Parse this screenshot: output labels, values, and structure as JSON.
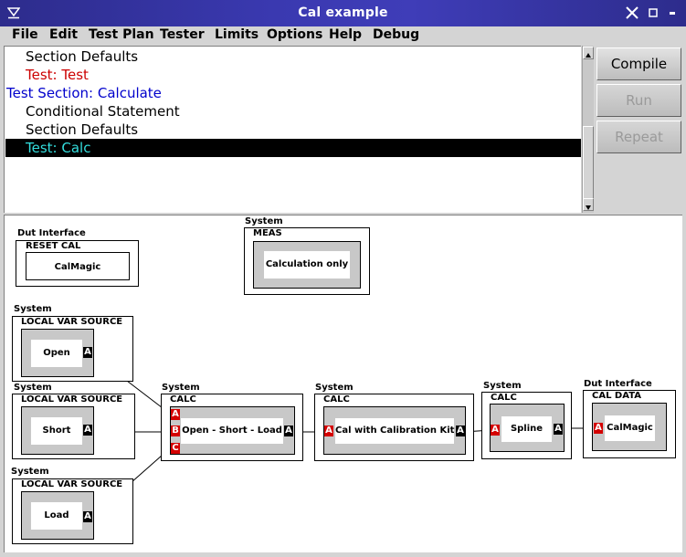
{
  "window": {
    "title": "Cal example"
  },
  "menu": [
    "File",
    "Edit",
    "Test Plan",
    "Tester",
    "Limits",
    "Options",
    "Help",
    "Debug"
  ],
  "list": {
    "rows": [
      {
        "text": "Section Defaults"
      },
      {
        "text": "Test: Test"
      },
      {
        "text": "Test Section: Calculate"
      },
      {
        "text": "Conditional Statement"
      },
      {
        "text": "Section Defaults"
      },
      {
        "text": "Test: Calc"
      }
    ]
  },
  "buttons": {
    "compile": "Compile",
    "run": "Run",
    "repeat": "Repeat"
  },
  "diagram": {
    "dut_reset": {
      "group": "Dut Interface",
      "type": "RESET CAL",
      "name": "CalMagic"
    },
    "meas": {
      "group": "System",
      "type": "MEAS",
      "name": "Calculation only"
    },
    "var_open": {
      "group": "System",
      "type": "LOCAL VAR SOURCE",
      "name": "Open",
      "port": "A"
    },
    "var_short": {
      "group": "System",
      "type": "LOCAL VAR SOURCE",
      "name": "Short",
      "port": "A"
    },
    "var_load": {
      "group": "System",
      "type": "LOCAL VAR SOURCE",
      "name": "Load",
      "port": "A"
    },
    "calc_osl": {
      "group": "System",
      "type": "CALC",
      "name": "Open - Short - Load",
      "in_ports": [
        "A",
        "B",
        "C"
      ],
      "out_port": "A"
    },
    "calc_kit": {
      "group": "System",
      "type": "CALC",
      "name": "Cal with Calibration Kit",
      "in_port": "A",
      "out_port": "A"
    },
    "calc_spline": {
      "group": "System",
      "type": "CALC",
      "name": "Spline",
      "in_port": "A",
      "out_port": "A"
    },
    "cal_data": {
      "group": "Dut Interface",
      "type": "CAL DATA",
      "name": "CalMagic",
      "in_port": "A"
    }
  },
  "colors": {
    "title_bar": "#3a39b0",
    "row_red": "#cc0000",
    "row_blue": "#0000cc",
    "row_selected_text": "#33dddd",
    "port_red": "#d40000"
  }
}
